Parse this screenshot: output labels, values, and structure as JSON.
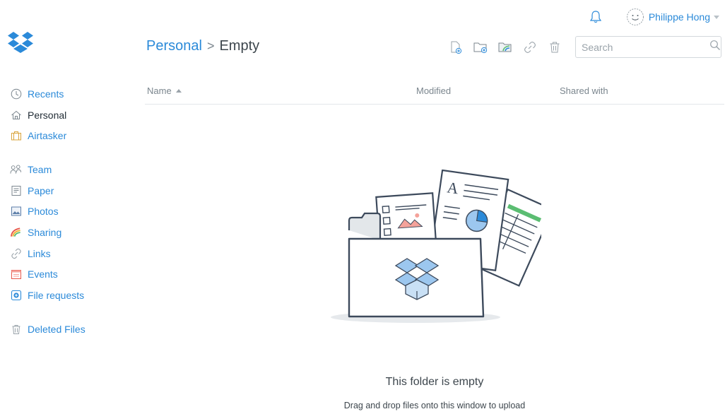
{
  "header": {
    "user_name": "Philippe Hong",
    "notifications_icon": "bell-icon",
    "avatar_icon": "smiley-avatar"
  },
  "sidebar": {
    "groups": [
      [
        {
          "label": "Recents",
          "icon": "clock-icon",
          "active": false
        },
        {
          "label": "Personal",
          "icon": "home-icon",
          "active": true
        },
        {
          "label": "Airtasker",
          "icon": "briefcase-icon",
          "active": false
        }
      ],
      [
        {
          "label": "Team",
          "icon": "team-icon",
          "active": false
        },
        {
          "label": "Paper",
          "icon": "paper-icon",
          "active": false
        },
        {
          "label": "Photos",
          "icon": "photos-icon",
          "active": false
        },
        {
          "label": "Sharing",
          "icon": "sharing-icon",
          "active": false
        },
        {
          "label": "Links",
          "icon": "link-icon",
          "active": false
        },
        {
          "label": "Events",
          "icon": "calendar-icon",
          "active": false
        },
        {
          "label": "File requests",
          "icon": "file-request-icon",
          "active": false
        }
      ],
      [
        {
          "label": "Deleted Files",
          "icon": "trash-icon",
          "active": false
        }
      ]
    ]
  },
  "breadcrumb": {
    "parent": "Personal",
    "separator": ">",
    "current": "Empty"
  },
  "toolbar": {
    "icons": [
      "upload-file-icon",
      "new-folder-icon",
      "new-shared-folder-icon",
      "share-link-icon",
      "delete-icon"
    ]
  },
  "search": {
    "placeholder": "Search",
    "value": ""
  },
  "table": {
    "columns": [
      "Name",
      "Modified",
      "Shared with"
    ],
    "sorted_by": "Name",
    "rows": []
  },
  "empty_state": {
    "title": "This folder is empty",
    "subtitle": "Drag and drop files onto this window to upload"
  },
  "colors": {
    "accent": "#2b8ad9",
    "text": "#3d464d",
    "muted": "#7b868e",
    "border": "#e3e7ea"
  }
}
